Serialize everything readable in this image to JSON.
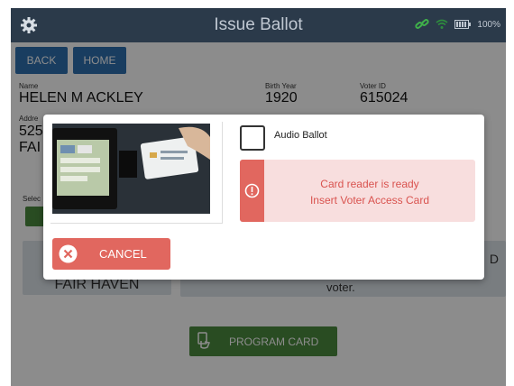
{
  "header": {
    "title": "Issue Ballot",
    "battery": "100%"
  },
  "nav": {
    "back": "BACK",
    "home": "HOME"
  },
  "voter": {
    "name_label": "Name",
    "name": "HELEN M ACKLEY",
    "birth_label": "Birth Year",
    "birth_year": "1920",
    "id_label": "Voter ID",
    "voter_id": "615024",
    "address_label": "Addre",
    "address_line1": "525",
    "address_line2": "FAI"
  },
  "background": {
    "section_label": "Selec",
    "party_partial": "FAIR HAVEN",
    "d_partial": "D",
    "voter_text": "voter.",
    "program_card": "PROGRAM CARD"
  },
  "modal": {
    "audio_ballot_label": "Audio Ballot",
    "audio_ballot_checked": false,
    "alert_line1": "Card reader is ready",
    "alert_line2": "Insert Voter Access Card",
    "cancel_label": "CANCEL"
  },
  "colors": {
    "topbar": "#2b3a4a",
    "nav_button": "#2e6fb0",
    "alert_accent": "#e1675f",
    "alert_bg": "#f8dede",
    "program_button": "#4c8a3f",
    "link_icon": "#3fb04a"
  },
  "icons": {
    "settings": "gear-icon",
    "link": "link-icon",
    "wifi": "wifi-icon",
    "battery": "battery-icon",
    "alert": "exclamation-circle-icon",
    "cancel": "x-circle-icon",
    "card": "card-hand-icon"
  }
}
